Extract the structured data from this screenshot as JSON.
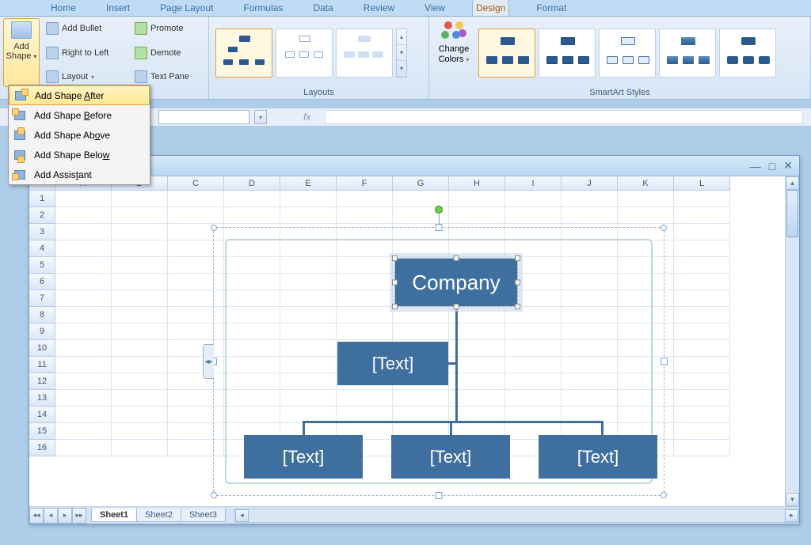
{
  "menu": [
    "Home",
    "Insert",
    "Page Layout",
    "Formulas",
    "Data",
    "Review",
    "View",
    "Design",
    "Format"
  ],
  "menu_active": "Design",
  "ribbon": {
    "addShape": {
      "label1": "Add",
      "label2": "Shape"
    },
    "createGroup": {
      "addBullet": "Add Bullet",
      "rtl": "Right to Left",
      "layout": "Layout",
      "promote": "Promote",
      "demote": "Demote",
      "textPane": "Text Pane"
    },
    "layoutsLabel": "Layouts",
    "changeColors": {
      "label1": "Change",
      "label2": "Colors"
    },
    "stylesLabel": "SmartArt Styles"
  },
  "dropdown": [
    {
      "html": "Add Shape <u>A</u>fter",
      "name": "add-shape-after",
      "hover": true,
      "icon": "after"
    },
    {
      "html": "Add Shape <u>B</u>efore",
      "name": "add-shape-before",
      "icon": "before"
    },
    {
      "html": "Add Shape Ab<u>o</u>ve",
      "name": "add-shape-above",
      "icon": "above"
    },
    {
      "html": "Add Shape Belo<u>w</u>",
      "name": "add-shape-below",
      "icon": "below"
    },
    {
      "html": "Add Assis<u>t</u>ant",
      "name": "add-assistant",
      "icon": "assist"
    }
  ],
  "formula": {
    "fx": "fx"
  },
  "columns": [
    "A",
    "B",
    "C",
    "D",
    "E",
    "F",
    "G",
    "H",
    "I",
    "J",
    "K",
    "L"
  ],
  "rows": [
    "1",
    "2",
    "3",
    "4",
    "5",
    "6",
    "7",
    "8",
    "9",
    "10",
    "11",
    "12",
    "13",
    "14",
    "15",
    "16"
  ],
  "sheets": [
    "Sheet1",
    "Sheet2",
    "Sheet3"
  ],
  "activeSheet": "Sheet1",
  "smartart": {
    "top": "Company",
    "assist": "[Text]",
    "c1": "[Text]",
    "c2": "[Text]",
    "c3": "[Text]"
  }
}
